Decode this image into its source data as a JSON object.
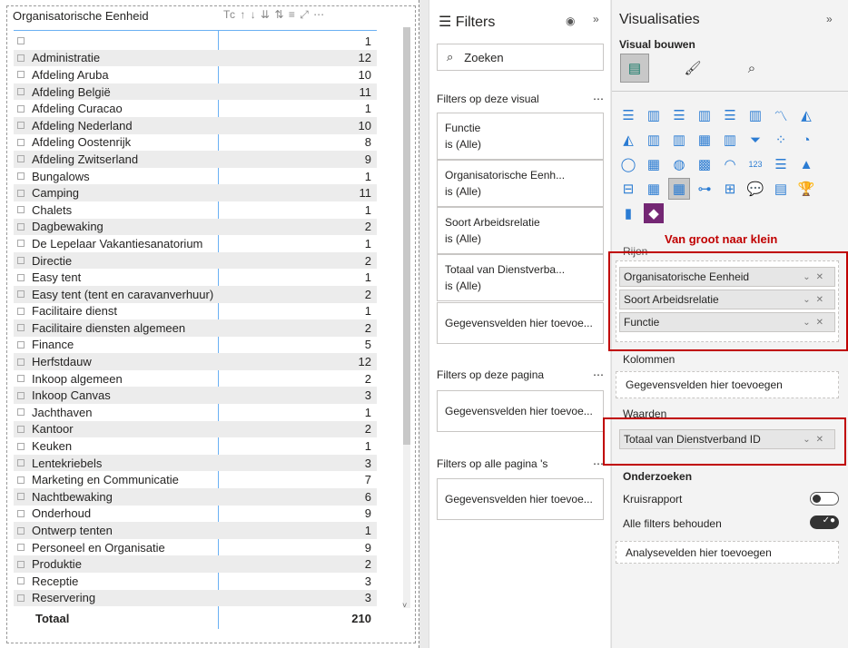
{
  "table": {
    "header": "Organisatorische Eenheid",
    "value_header_truncated": "Tc",
    "rows": [
      [
        "",
        1
      ],
      [
        "Administratie",
        12
      ],
      [
        "Afdeling Aruba",
        10
      ],
      [
        "Afdeling België",
        11
      ],
      [
        "Afdeling Curacao",
        1
      ],
      [
        "Afdeling Nederland",
        10
      ],
      [
        "Afdeling Oostenrijk",
        8
      ],
      [
        "Afdeling Zwitserland",
        9
      ],
      [
        "Bungalows",
        1
      ],
      [
        "Camping",
        11
      ],
      [
        "Chalets",
        1
      ],
      [
        "Dagbewaking",
        2
      ],
      [
        "De Lepelaar Vakantiesanatorium",
        1
      ],
      [
        "Directie",
        2
      ],
      [
        "Easy tent",
        1
      ],
      [
        "Easy tent (tent en caravanverhuur)",
        2
      ],
      [
        "Facilitaire dienst",
        1
      ],
      [
        "Facilitaire diensten algemeen",
        2
      ],
      [
        "Finance",
        5
      ],
      [
        "Herfstdauw",
        12
      ],
      [
        "Inkoop algemeen",
        2
      ],
      [
        "Inkoop Canvas",
        3
      ],
      [
        "Jachthaven",
        1
      ],
      [
        "Kantoor",
        2
      ],
      [
        "Keuken",
        1
      ],
      [
        "Lentekriebels",
        3
      ],
      [
        "Marketing en Communicatie",
        7
      ],
      [
        "Nachtbewaking",
        6
      ],
      [
        "Onderhoud",
        9
      ],
      [
        "Ontwerp tenten",
        1
      ],
      [
        "Personeel en Organisatie",
        9
      ],
      [
        "Produktie",
        2
      ],
      [
        "Receptie",
        3
      ],
      [
        "Reservering",
        3
      ]
    ],
    "total_label": "Totaal",
    "total_value": 210
  },
  "filters": {
    "title": "Filters",
    "search_placeholder": "Zoeken",
    "visual_section": "Filters op deze visual",
    "visual_cards": [
      {
        "name": "Functie",
        "state": "is (Alle)"
      },
      {
        "name": "Organisatorische Eenh...",
        "state": "is (Alle)"
      },
      {
        "name": "Soort Arbeidsrelatie",
        "state": "is (Alle)"
      },
      {
        "name": "Totaal van Dienstverba...",
        "state": "is (Alle)"
      }
    ],
    "add_fields": "Gegevensvelden hier toevoe...",
    "page_section": "Filters op deze pagina",
    "all_section": "Filters op alle pagina 's"
  },
  "viz": {
    "title": "Visualisaties",
    "build": "Visual bouwen",
    "annotation": "Van groot naar klein",
    "rows_label": "Rijen",
    "rows": [
      "Organisatorische Eenheid",
      "Soort Arbeidsrelatie",
      "Functie"
    ],
    "columns_label": "Kolommen",
    "columns_placeholder": "Gegevensvelden hier toevoegen",
    "values_label": "Waarden",
    "values": [
      "Totaal van Dienstverband ID"
    ],
    "drill_label": "Onderzoeken",
    "cross_report": "Kruisrapport",
    "keep_filters": "Alle filters behouden",
    "cross_report_on": false,
    "keep_filters_on": true,
    "analysis_placeholder": "Analysevelden hier toevoegen",
    "icons": [
      "stacked-bar",
      "stacked-column",
      "clustered-bar",
      "clustered-column",
      "100-bar",
      "100-column",
      "line",
      "area",
      "stacked-area",
      "line-column",
      "line-clustered",
      "ribbon",
      "waterfall",
      "funnel",
      "scatter",
      "pie",
      "donut",
      "treemap",
      "map",
      "filled-map",
      "gauge",
      "card",
      "multi-row-card",
      "kpi",
      "slicer",
      "table",
      "matrix",
      "key-influencers",
      "decomposition-tree",
      "qa",
      "narrative",
      "goals",
      "paginated",
      "power-apps"
    ]
  },
  "colors": {
    "accent": "#2b7cd3",
    "annotation": "#c00000"
  }
}
